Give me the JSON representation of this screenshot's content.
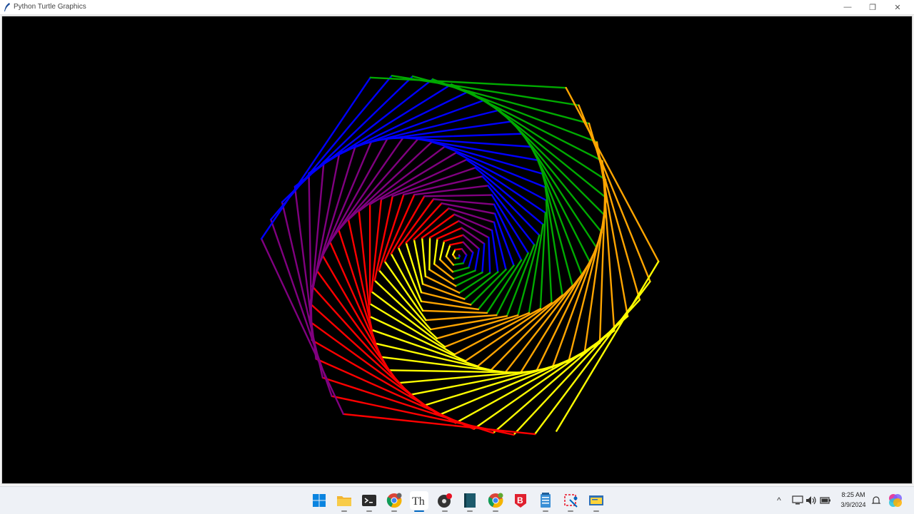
{
  "window": {
    "title": "Python Turtle Graphics",
    "controls": {
      "minimize": "—",
      "maximize": "❐",
      "close": "✕"
    }
  },
  "canvas": {
    "background": "#000000",
    "drawing": {
      "type": "spiral-hexagon",
      "sides": 6,
      "colors": [
        "#ff0000",
        "#800080",
        "#0000ff",
        "#00aa00",
        "#ffa500",
        "#ffff00"
      ]
    }
  },
  "taskbar": {
    "apps": [
      {
        "name": "start-icon"
      },
      {
        "name": "file-explorer-icon"
      },
      {
        "name": "terminal-icon"
      },
      {
        "name": "chrome-icon"
      },
      {
        "name": "thonny-icon",
        "label": "Th",
        "active": true
      },
      {
        "name": "obs-icon"
      },
      {
        "name": "notebook-icon"
      },
      {
        "name": "chrome-profile-icon"
      },
      {
        "name": "brave-icon",
        "label": "B"
      },
      {
        "name": "notepad-icon"
      },
      {
        "name": "snipping-tool-icon"
      },
      {
        "name": "python-idle-icon"
      }
    ],
    "tray": {
      "chevron": "^",
      "clock_time": "8:25 AM",
      "clock_date": "3/9/2024"
    }
  }
}
